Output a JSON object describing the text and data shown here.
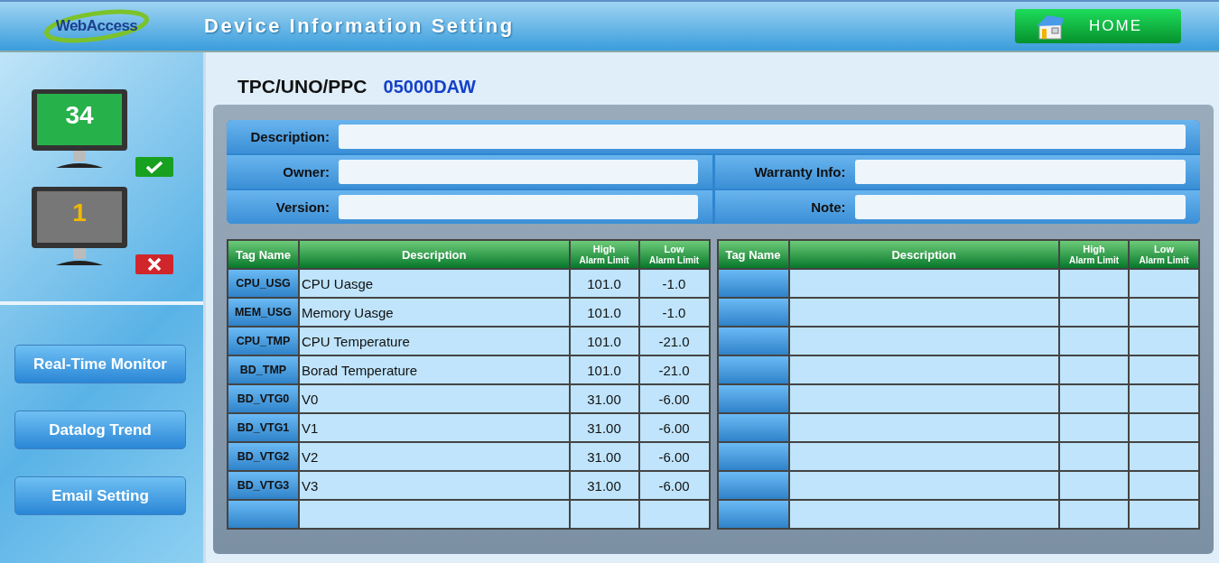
{
  "header": {
    "logo": "WebAccess",
    "title": "Device Information Setting",
    "home_button": "HOME"
  },
  "sidebar": {
    "monitors": [
      {
        "count": "34",
        "kind": "online"
      },
      {
        "count": "1",
        "kind": "offline"
      }
    ],
    "nav": [
      "Real-Time Monitor",
      "Datalog Trend",
      "Email Setting"
    ]
  },
  "device": {
    "type": "TPC/UNO/PPC",
    "id": "05000DAW"
  },
  "form": {
    "description": "Description:",
    "owner": "Owner:",
    "warranty": "Warranty Info:",
    "version": "Version:",
    "note": "Note:"
  },
  "tables": [
    {
      "columns": [
        "Tag Name",
        "Description",
        "High",
        "Alarm Limit",
        "Low",
        "Alarm Limit"
      ],
      "rows": [
        {
          "kind": "data",
          "tag": "CPU_USG",
          "description": "CPU Uasge",
          "high": "101.0",
          "low": "-1.0"
        },
        {
          "kind": "data",
          "tag": "MEM_USG",
          "description": "Memory Uasge",
          "high": "101.0",
          "low": "-1.0"
        },
        {
          "kind": "data",
          "tag": "CPU_TMP",
          "description": "CPU Temperature",
          "high": "101.0",
          "low": "-21.0"
        },
        {
          "kind": "data",
          "tag": "BD_TMP",
          "description": "Borad Temperature",
          "high": "101.0",
          "low": "-21.0"
        },
        {
          "kind": "data",
          "tag": "BD_VTG0",
          "description": "V0",
          "high": "31.00",
          "low": "-6.00"
        },
        {
          "kind": "data",
          "tag": "BD_VTG1",
          "description": "V1",
          "high": "31.00",
          "low": "-6.00"
        },
        {
          "kind": "data",
          "tag": "BD_VTG2",
          "description": "V2",
          "high": "31.00",
          "low": "-6.00"
        },
        {
          "kind": "data",
          "tag": "BD_VTG3",
          "description": "V3",
          "high": "31.00",
          "low": "-6.00"
        },
        {
          "kind": "blank"
        }
      ]
    },
    {
      "columns": [
        "Tag Name",
        "Description",
        "High",
        "Alarm Limit",
        "Low",
        "Alarm Limit"
      ],
      "rows": [
        {
          "kind": "blank"
        },
        {
          "kind": "blank"
        },
        {
          "kind": "blank"
        },
        {
          "kind": "blank"
        },
        {
          "kind": "blank"
        },
        {
          "kind": "blank"
        },
        {
          "kind": "blank"
        },
        {
          "kind": "blank"
        },
        {
          "kind": "blank"
        }
      ]
    }
  ]
}
